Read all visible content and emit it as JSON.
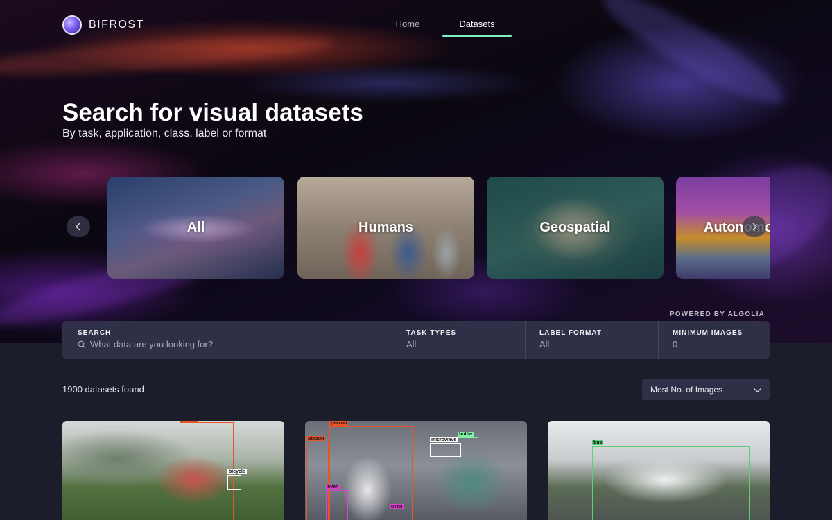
{
  "brand": {
    "name": "BIFROST",
    "accent": "#7ff0c4"
  },
  "nav": {
    "items": [
      {
        "label": "Home",
        "active": false
      },
      {
        "label": "Datasets",
        "active": true
      }
    ]
  },
  "hero": {
    "title": "Search for visual datasets",
    "subtitle": "By task, application, class, label or format"
  },
  "carousel": {
    "cards": [
      {
        "label": "All"
      },
      {
        "label": "Humans"
      },
      {
        "label": "Geospatial"
      },
      {
        "label": "Autonomous Vehicles"
      }
    ],
    "prev_icon": "chevron-left-icon",
    "next_icon": "chevron-right-icon"
  },
  "powered_by": "POWERED BY ALGOLIA",
  "search": {
    "title": "SEARCH",
    "placeholder": "What data are you looking for?",
    "task_types": {
      "title": "TASK TYPES",
      "value": "All"
    },
    "label_format": {
      "title": "LABEL FORMAT",
      "value": "All"
    },
    "minimum_images": {
      "title": "MINIMUM IMAGES",
      "value": "0"
    }
  },
  "results": {
    "count_text": "1900 datasets found",
    "sort": {
      "value": "Most No. of Images"
    }
  },
  "tiles": [
    {
      "labels": [
        {
          "text": "person",
          "color": "#e8552b"
        },
        {
          "text": "bicycle",
          "color": "#ffffff"
        }
      ]
    },
    {
      "labels": [
        {
          "text": "person",
          "color": "#e8552b"
        },
        {
          "text": "person",
          "color": "#e8552b"
        },
        {
          "text": "microwave",
          "color": "#ffffff"
        },
        {
          "text": "bottle",
          "color": "#7ff0a4"
        },
        {
          "text": "oven",
          "color": "#e040d0"
        },
        {
          "text": "oven",
          "color": "#e040d0"
        }
      ]
    },
    {
      "labels": [
        {
          "text": "bus",
          "color": "#5ad17a"
        }
      ]
    }
  ]
}
